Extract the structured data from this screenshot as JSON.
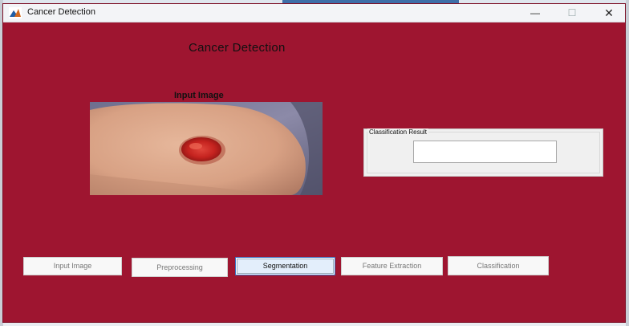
{
  "window": {
    "title": "Cancer Detection",
    "controls": {
      "minimize": "—",
      "maximize": "☐",
      "close": "✕"
    }
  },
  "main": {
    "heading": "Cancer Detection",
    "image_caption": "Input Image"
  },
  "classification": {
    "legend": "Classification Result",
    "value": ""
  },
  "buttons": {
    "input_image": "Input Image",
    "preprocessing": "Preprocessing",
    "segmentation": "Segmentation",
    "feature_extraction": "Feature Extraction",
    "classification": "Classification"
  },
  "colors": {
    "figure_background": "#9e1530",
    "active_button_border": "#3c6fc2"
  }
}
